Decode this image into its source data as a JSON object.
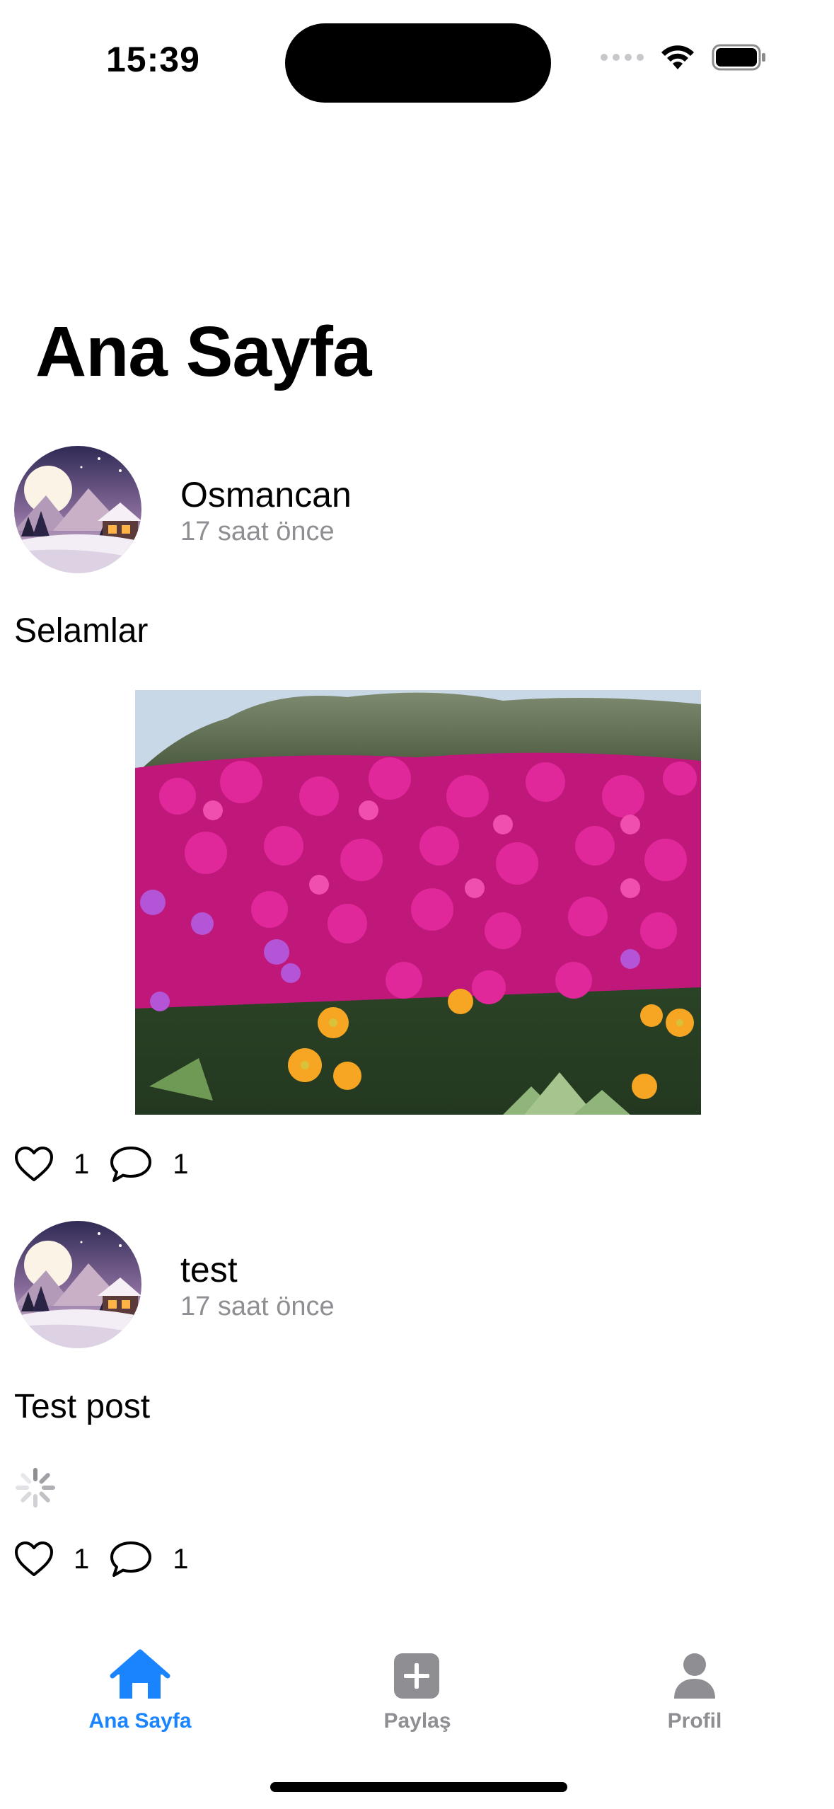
{
  "status_bar": {
    "time": "15:39"
  },
  "page": {
    "title": "Ana Sayfa"
  },
  "posts": [
    {
      "author": "Osmancan",
      "time_ago": "17 saat önce",
      "text": "Selamlar",
      "has_image": true,
      "image_subject": "pink-flowers-field",
      "likes": "1",
      "comments": "1"
    },
    {
      "author": "test",
      "time_ago": "17 saat önce",
      "text": "Test post",
      "has_image": false,
      "image_loading": true,
      "likes": "1",
      "comments": "1"
    }
  ],
  "tab_bar": {
    "tabs": [
      {
        "label": "Ana Sayfa",
        "icon": "house-icon",
        "active": true
      },
      {
        "label": "Paylaş",
        "icon": "plus-square-icon",
        "active": false
      },
      {
        "label": "Profil",
        "icon": "person-icon",
        "active": false
      }
    ],
    "active_color": "#1a84ff",
    "inactive_color": "#8e8e93"
  }
}
